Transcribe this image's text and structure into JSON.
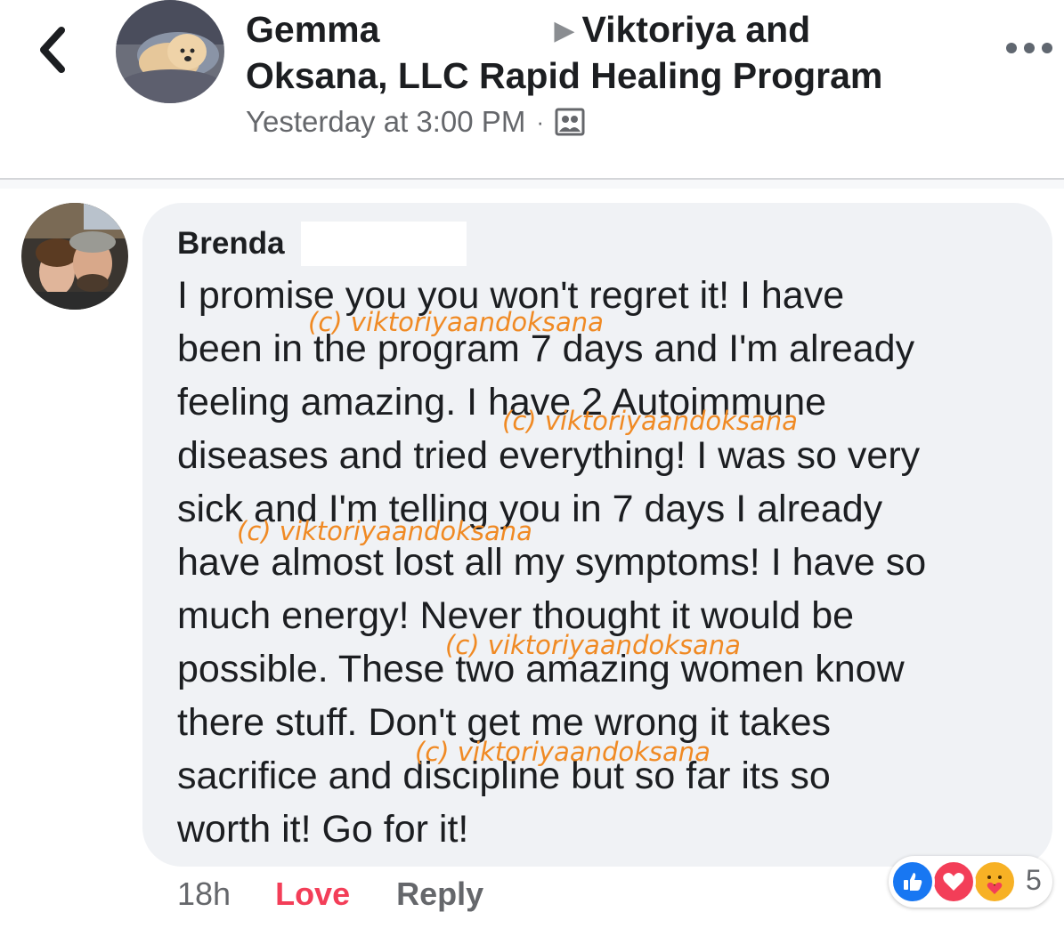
{
  "header": {
    "author": "Gemma",
    "group_name_line1": "Viktoriya and",
    "group_name_line2": "Oksana, LLC Rapid Healing Program",
    "timestamp": "Yesterday at 3:00 PM",
    "separator": "·",
    "audience_icon": "group-privacy-icon",
    "back_icon": "chevron-left-icon",
    "more_icon": "more-horizontal-icon"
  },
  "comment": {
    "author": "Brenda",
    "lines": [
      "I promise you you won't regret it! I have",
      "been in the program 7 days and I'm already",
      "feeling amazing. I have 2 Autoimmune",
      "diseases and tried everything! I was so very",
      "sick and I'm telling you in 7 days I already",
      "have almost lost all my symptoms! I have so",
      "much energy! Never thought it would be",
      "possible. These two amazing women know",
      "there stuff. Don't get me wrong it takes",
      "sacrifice and discipline but so far its so",
      "worth it! Go for it!"
    ],
    "watermark": "(c) viktoriyaandoksana",
    "time_ago": "18h",
    "love_label": "Love",
    "reply_label": "Reply",
    "reaction_icons": [
      "like-icon",
      "love-icon",
      "care-icon"
    ],
    "reaction_count": "5"
  },
  "colors": {
    "love": "#f33e58",
    "like": "#1877f2",
    "watermark": "#f08a24",
    "bubble": "#f0f2f5"
  }
}
